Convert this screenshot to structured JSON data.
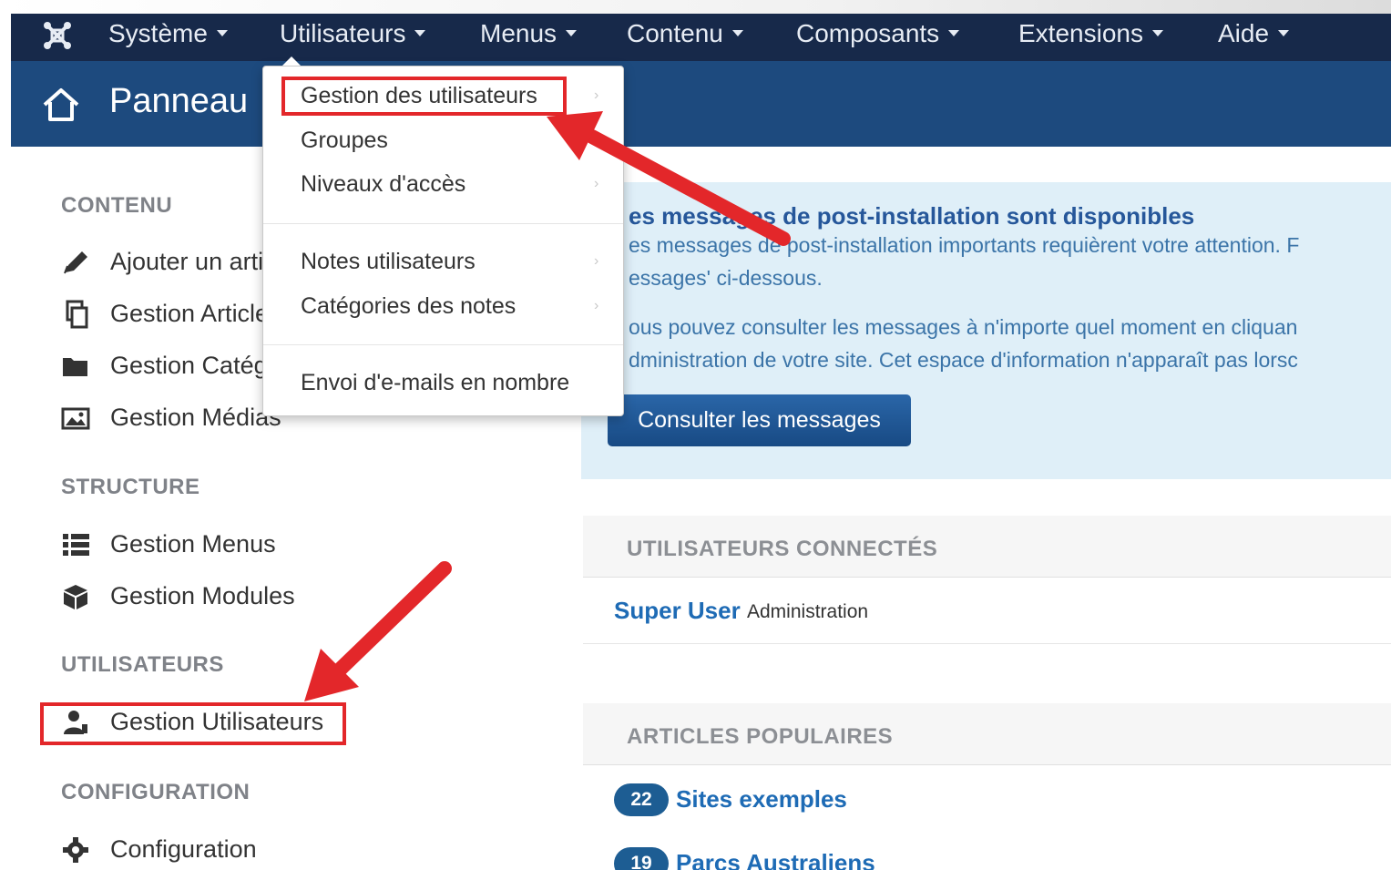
{
  "navbar": {
    "items": [
      {
        "label": "Système"
      },
      {
        "label": "Utilisateurs"
      },
      {
        "label": "Menus"
      },
      {
        "label": "Contenu"
      },
      {
        "label": "Composants"
      },
      {
        "label": "Extensions"
      },
      {
        "label": "Aide"
      }
    ]
  },
  "header": {
    "title": "Panneau"
  },
  "dropdown": {
    "items": [
      {
        "label": "Gestion des utilisateurs"
      },
      {
        "label": "Groupes"
      },
      {
        "label": "Niveaux d'accès"
      },
      {
        "label": "Notes utilisateurs"
      },
      {
        "label": "Catégories des notes"
      },
      {
        "label": "Envoi d'e-mails en nombre"
      }
    ]
  },
  "sidebar": {
    "sections": [
      {
        "heading": "CONTENU",
        "items": [
          {
            "label": "Ajouter un article",
            "icon": "pencil-icon"
          },
          {
            "label": "Gestion Articles",
            "icon": "copy-icon"
          },
          {
            "label": "Gestion Catégories",
            "icon": "folder-icon"
          },
          {
            "label": "Gestion Médias",
            "icon": "image-icon"
          }
        ]
      },
      {
        "heading": "STRUCTURE",
        "items": [
          {
            "label": "Gestion Menus",
            "icon": "list-icon"
          },
          {
            "label": "Gestion Modules",
            "icon": "cube-icon"
          }
        ]
      },
      {
        "heading": "UTILISATEURS",
        "items": [
          {
            "label": "Gestion Utilisateurs",
            "icon": "user-icon"
          }
        ]
      },
      {
        "heading": "CONFIGURATION",
        "items": [
          {
            "label": "Configuration",
            "icon": "gear-icon"
          }
        ]
      }
    ]
  },
  "alert": {
    "title": "es messages de post-installation sont disponibles",
    "line1": "es messages de post-installation importants requièrent votre attention. F",
    "line2": "essages' ci-dessous.",
    "line3": "ous pouvez consulter les messages à n'importe quel moment en cliquan",
    "line4": "dministration de votre site. Cet espace d'information n'apparaît pas lorsc",
    "button": "Consulter les messages"
  },
  "logged_users": {
    "title": "UTILISATEURS CONNECTÉS",
    "user": "Super User",
    "role": "Administration"
  },
  "popular": {
    "title": "ARTICLES POPULAIRES",
    "items": [
      {
        "count": "22",
        "title": "Sites exemples"
      },
      {
        "count": "19",
        "title": "Parcs Australiens"
      }
    ]
  },
  "colors": {
    "navbar": "#17294a",
    "header": "#1d4a7e",
    "highlight": "#e3272a",
    "link": "#1e6bb5"
  }
}
